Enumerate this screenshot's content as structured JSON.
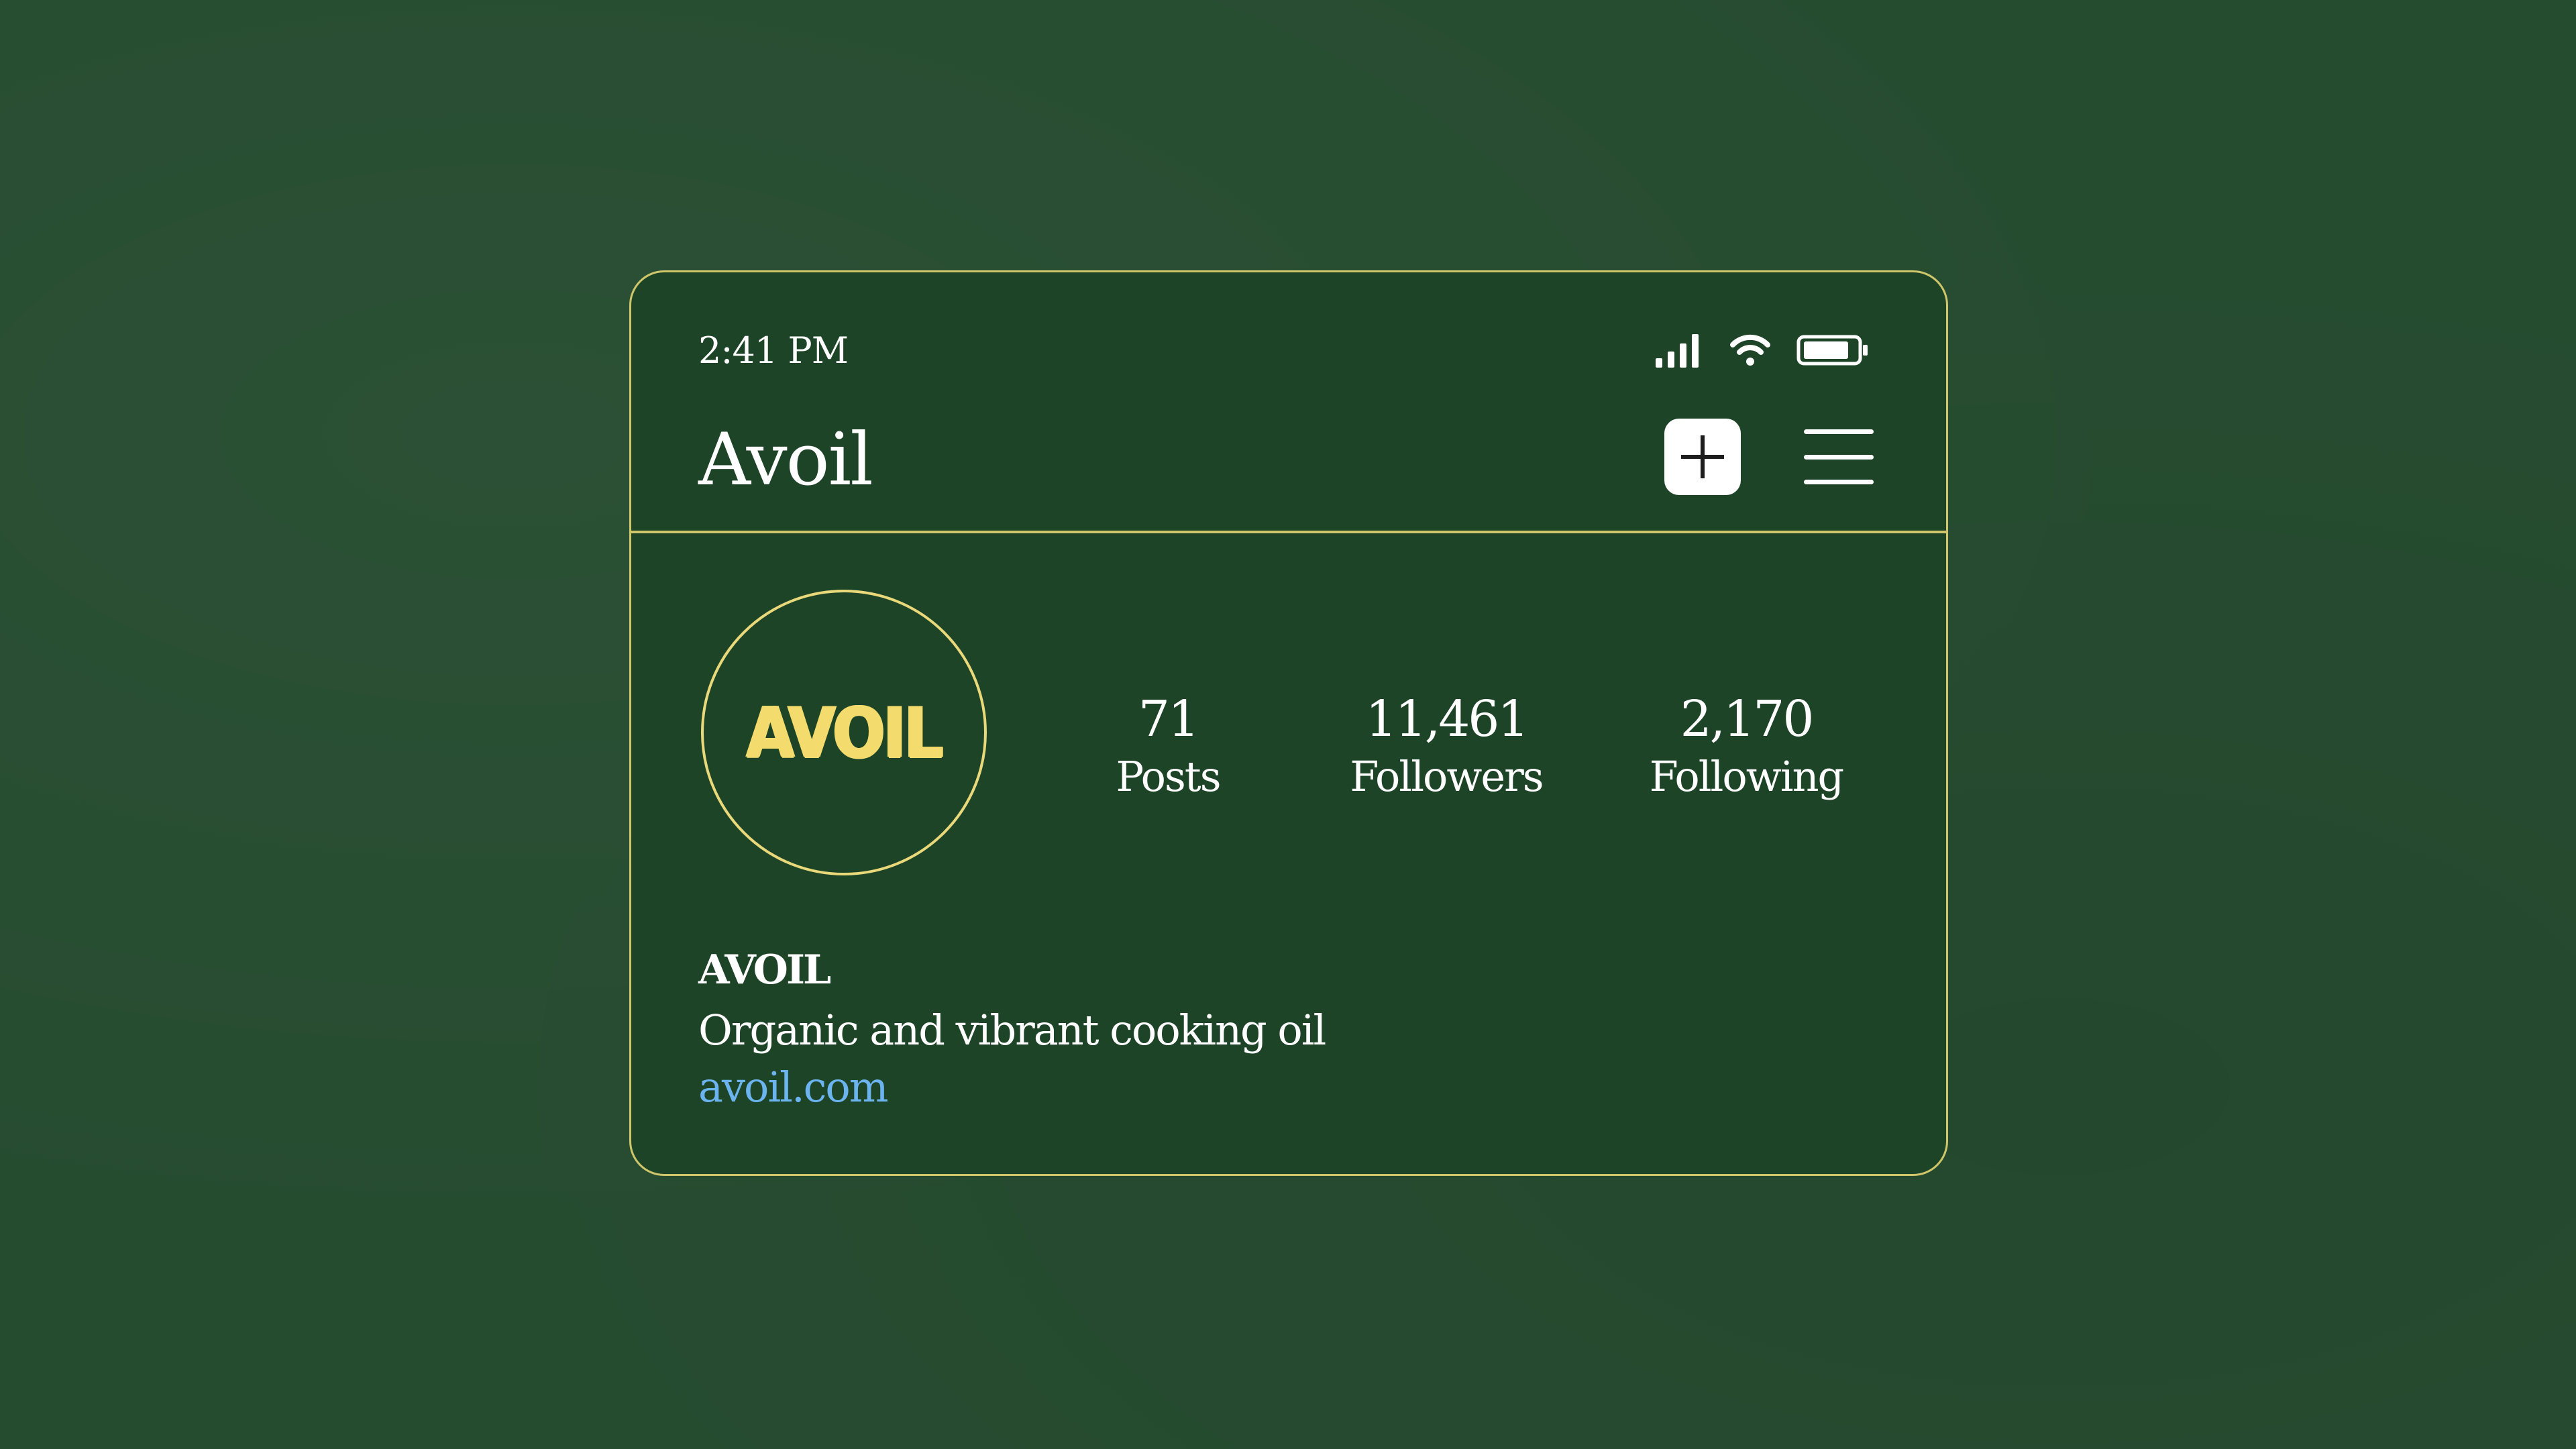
{
  "status_bar": {
    "time": "2:41 PM",
    "icons": [
      "cellular-signal-icon",
      "wifi-icon",
      "battery-icon"
    ]
  },
  "header": {
    "title": "Avoil",
    "add_icon": "plus-square-icon",
    "menu_icon": "hamburger-menu-icon"
  },
  "profile": {
    "avatar_logo_text": "AVOIL",
    "stats": [
      {
        "value": "71",
        "label": "Posts"
      },
      {
        "value": "11,461",
        "label": "Followers"
      },
      {
        "value": "2,170",
        "label": "Following"
      }
    ],
    "name": "AVOIL",
    "bio": "Organic and vibrant cooking oil",
    "link": "avoil.com"
  },
  "colors": {
    "background": "#264c30",
    "card": "#1d4427",
    "border": "#cfc66c",
    "logo": "#f3dc6d",
    "link": "#6cb4ef",
    "text": "#ffffff"
  }
}
